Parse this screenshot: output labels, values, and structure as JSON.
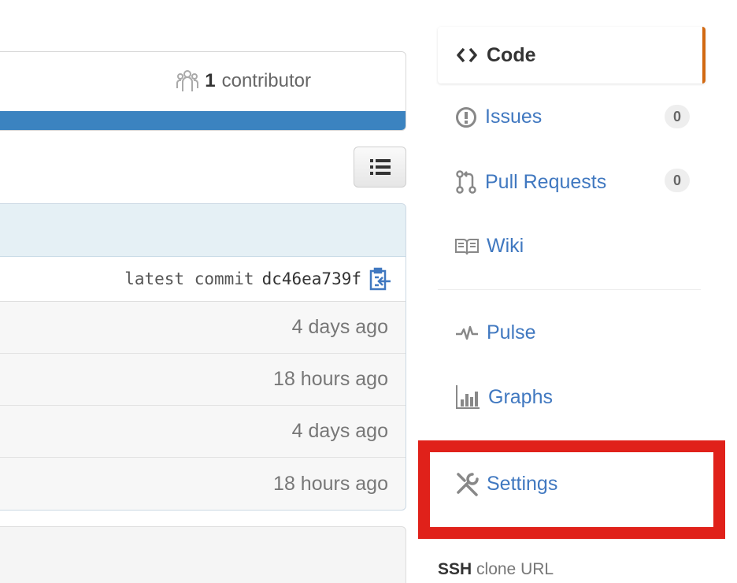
{
  "repo_summary": {
    "contributors_count": "1",
    "contributors_label": "contributor",
    "language_bar_color": "#3b83c0"
  },
  "file_table": {
    "commit_label": "latest commit",
    "commit_sha": "dc46ea739f",
    "rows": [
      {
        "age": "4 days ago"
      },
      {
        "age": "18 hours ago"
      },
      {
        "age": "4 days ago"
      },
      {
        "age": "18 hours ago"
      }
    ]
  },
  "sidebar": {
    "code_label": "Code",
    "issues_label": "Issues",
    "issues_count": "0",
    "pulls_label": "Pull Requests",
    "pulls_count": "0",
    "wiki_label": "Wiki",
    "pulse_label": "Pulse",
    "graphs_label": "Graphs",
    "settings_label": "Settings",
    "active_accent": "#d26911",
    "link_color": "#4078c0",
    "highlight_color": "#e0211a"
  },
  "clone": {
    "protocol": "SSH",
    "label": "clone URL"
  }
}
